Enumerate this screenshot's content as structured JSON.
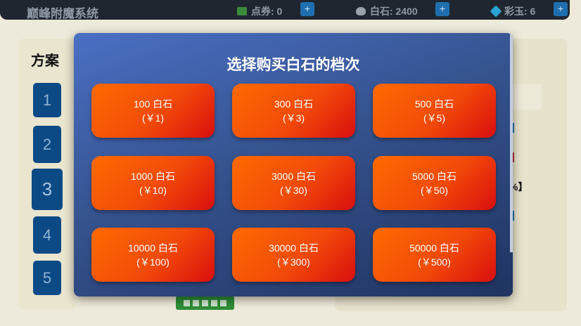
{
  "app": {
    "title": "巅峰附魔系统"
  },
  "currencies": [
    {
      "icon": "ticket-icon",
      "label": "点券: 0",
      "plus": "+"
    },
    {
      "icon": "stone-icon",
      "label": "白石: 2400",
      "plus": "+"
    },
    {
      "icon": "jade-icon",
      "label": "彩玉: 6",
      "plus": "+"
    }
  ],
  "background": {
    "scheme_title": "方案",
    "schemes": [
      "1",
      "2",
      "3",
      "4",
      "5"
    ],
    "right_fragment": "%】"
  },
  "modal": {
    "title": "选择购买白石的档次",
    "tiers": [
      {
        "amount": "100 白石",
        "price": "(￥1)"
      },
      {
        "amount": "300 白石",
        "price": "(￥3)"
      },
      {
        "amount": "500 白石",
        "price": "(￥5)"
      },
      {
        "amount": "1000 白石",
        "price": "(￥10)"
      },
      {
        "amount": "3000 白石",
        "price": "(￥30)"
      },
      {
        "amount": "5000 白石",
        "price": "(￥50)"
      },
      {
        "amount": "10000 白石",
        "price": "(￥100)"
      },
      {
        "amount": "30000 白石",
        "price": "(￥300)"
      },
      {
        "amount": "50000 白石",
        "price": "(￥500)"
      }
    ]
  },
  "colors": {
    "accent_orange": "#ff6a00",
    "accent_red": "#d90e0e",
    "modal_blue": "#36538f",
    "scheme_blue": "#0c4a86"
  }
}
